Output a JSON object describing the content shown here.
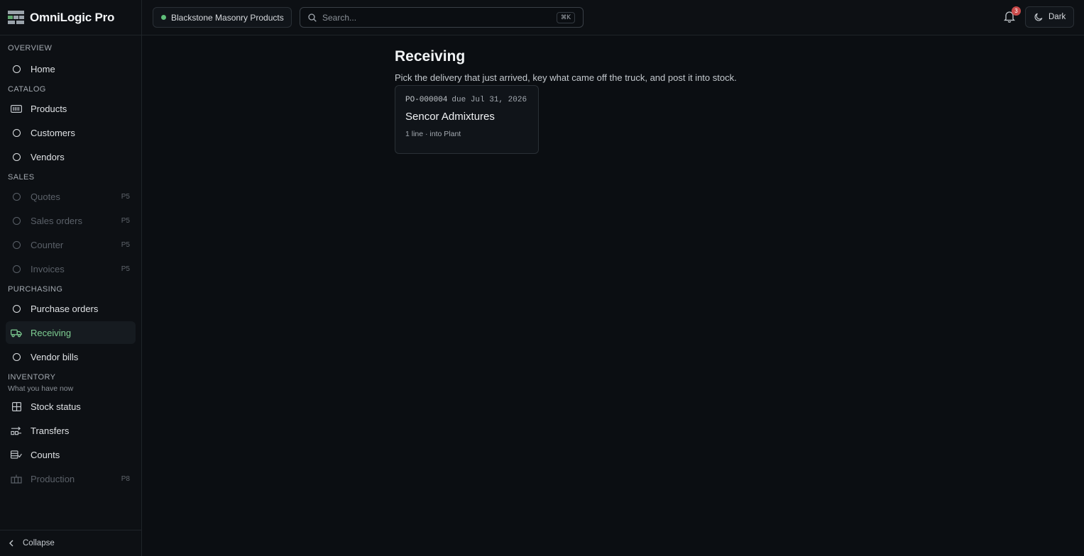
{
  "app": {
    "title": "OmniLogic Pro"
  },
  "sidebar": {
    "sections": [
      {
        "label": "OVERVIEW",
        "items": [
          {
            "label": "Home",
            "icon": "circle-icon"
          }
        ]
      },
      {
        "label": "CATALOG",
        "items": [
          {
            "label": "Products",
            "icon": "barcode-icon"
          },
          {
            "label": "Customers",
            "icon": "circle-icon"
          },
          {
            "label": "Vendors",
            "icon": "circle-icon"
          }
        ]
      },
      {
        "label": "SALES",
        "items": [
          {
            "label": "Quotes",
            "phase": "P5"
          },
          {
            "label": "Sales orders",
            "phase": "P5"
          },
          {
            "label": "Counter",
            "phase": "P5"
          },
          {
            "label": "Invoices",
            "phase": "P5"
          }
        ]
      },
      {
        "label": "PURCHASING",
        "items": [
          {
            "label": "Purchase orders"
          },
          {
            "label": "Receiving",
            "icon": "truck-icon",
            "active": true
          },
          {
            "label": "Vendor bills"
          }
        ]
      },
      {
        "label": "INVENTORY",
        "sublabel": "What you have now",
        "items": [
          {
            "label": "Stock status",
            "icon": "grid-icon"
          },
          {
            "label": "Transfers",
            "icon": "transfer-icon"
          },
          {
            "label": "Counts",
            "icon": "checklist-icon"
          },
          {
            "label": "Production",
            "icon": "factory-icon",
            "phase": "P8"
          }
        ]
      }
    ],
    "collapse_label": "Collapse"
  },
  "topbar": {
    "company": "Blackstone Masonry Products",
    "company_status_color": "#5fbf7a",
    "search_placeholder": "Search...",
    "search_shortcut": "⌘K",
    "notifications_count": "3",
    "theme_label": "Dark"
  },
  "page": {
    "title": "Receiving",
    "subtitle": "Pick the delivery that just arrived, key what came off the truck, and post it into stock.",
    "purchase_orders": [
      {
        "number": "PO-000004",
        "due": "due Jul 31, 2026",
        "vendor": "Sencor Admixtures",
        "meta": "1 line · into Plant"
      }
    ]
  },
  "colors": {
    "accent": "#7fcf93",
    "background": "#0b0e12",
    "badge": "#c94a4a"
  }
}
